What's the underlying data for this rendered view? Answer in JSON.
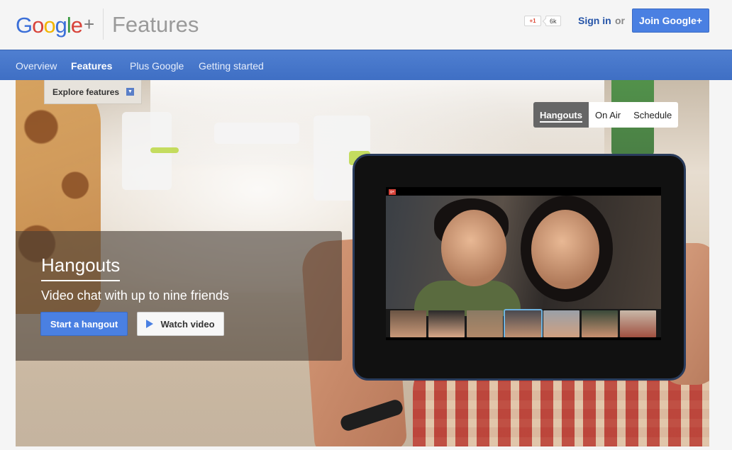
{
  "header": {
    "logo_text": "Google+",
    "section_title": "Features",
    "plusone_label": "+1",
    "plusone_count": "6k",
    "signin_label": "Sign in",
    "or_label": "or",
    "join_label": "Join Google+"
  },
  "nav": {
    "items": [
      {
        "label": "Overview",
        "active": false
      },
      {
        "label": "Features",
        "active": true
      },
      {
        "label": "Plus Google",
        "active": false
      },
      {
        "label": "Getting started",
        "active": false
      }
    ]
  },
  "hero": {
    "explore_label": "Explore features",
    "tabs": [
      {
        "label": "Hangouts",
        "active": true
      },
      {
        "label": "On Air",
        "active": false
      },
      {
        "label": "Schedule",
        "active": false
      }
    ],
    "title": "Hangouts",
    "subtitle": "Video chat with up to nine friends",
    "start_label": "Start a hangout",
    "watch_label": "Watch video"
  },
  "colors": {
    "nav_bar": "#4a7acd",
    "primary_button": "#4a80e2",
    "link": "#2554a8"
  },
  "icons": [
    "plusone-icon",
    "chevron-down-icon",
    "play-icon",
    "google-plus-icon"
  ]
}
